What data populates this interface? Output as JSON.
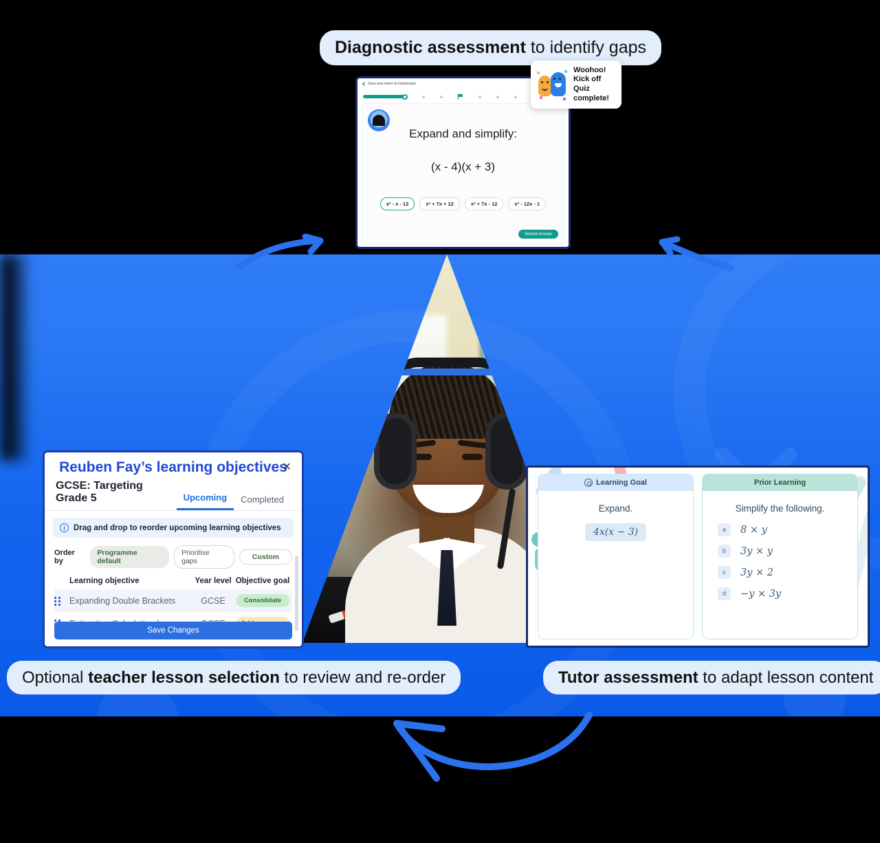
{
  "captions": {
    "top": {
      "bold": "Diagnostic assessment",
      "rest": " to identify gaps"
    },
    "bottom_left": {
      "pre": "Optional ",
      "bold": "teacher lesson selection",
      "rest": " to review and re-order"
    },
    "bottom_right": {
      "bold": "Tutor assessment",
      "rest": " to adapt lesson content"
    }
  },
  "quiz": {
    "back_label": "Save and return to Dashboard",
    "question": "Expand and simplify:",
    "equation": "(x - 4)(x + 3)",
    "options": [
      {
        "label": "x² - x - 12",
        "selected": true
      },
      {
        "label": "x² + 7x + 12",
        "selected": false
      },
      {
        "label": "x² + 7x - 12",
        "selected": false
      },
      {
        "label": "x² - 12x - 1",
        "selected": false
      }
    ],
    "submit_label": "Submit Answer",
    "progress": {
      "completed_steps": 1,
      "total_dots": 6,
      "flag_index": 2,
      "accent_color": "#0f9b8e"
    }
  },
  "toast": {
    "line1": "Woohoo!",
    "line2": "Kick off Quiz",
    "line3": "complete!"
  },
  "learning_objectives": {
    "title": "Reuben Fay’s learning objectives",
    "close_label": "×",
    "subtitle": "GCSE: Targeting Grade 5",
    "tabs": [
      {
        "label": "Upcoming",
        "active": true
      },
      {
        "label": "Completed",
        "active": false
      }
    ],
    "banner": "Drag and drop to reorder upcoming learning objectives",
    "order_by_label": "Order by",
    "order_chips": [
      {
        "label": "Programme default",
        "state": "selected"
      },
      {
        "label": "Prioritise gaps",
        "state": "default"
      },
      {
        "label": "Custom",
        "state": "outline"
      }
    ],
    "columns": [
      "Learning objective",
      "Year level",
      "Objective goal"
    ],
    "rows": [
      {
        "name": "Expanding Double Brackets",
        "year": "GCSE",
        "goal": "Consolidate",
        "goal_style": "green"
      },
      {
        "name": "Estimating Calculationd",
        "year": "GCSE",
        "goal": "Address gaps",
        "goal_style": "amber"
      }
    ],
    "save_label": "Save Changes",
    "accent_color": "#2b6fe0"
  },
  "tutor_assessment": {
    "left": {
      "header": "Learning Goal",
      "icon": "target-icon",
      "question": "Expand.",
      "expression": "4x(x − 3)"
    },
    "right": {
      "header": "Prior Learning",
      "question": "Simplify the following.",
      "items": [
        {
          "key": "a",
          "value": "8 × y"
        },
        {
          "key": "b",
          "value": "3y × y"
        },
        {
          "key": "c",
          "value": "3y × 2"
        },
        {
          "key": "d",
          "value": "−y × 3y"
        }
      ]
    }
  },
  "theme": {
    "brand_blue": "#1f6fe0",
    "band_blue": "#1466ef",
    "teal": "#0f9b8e",
    "bubble_bg": "#e3eefd"
  }
}
